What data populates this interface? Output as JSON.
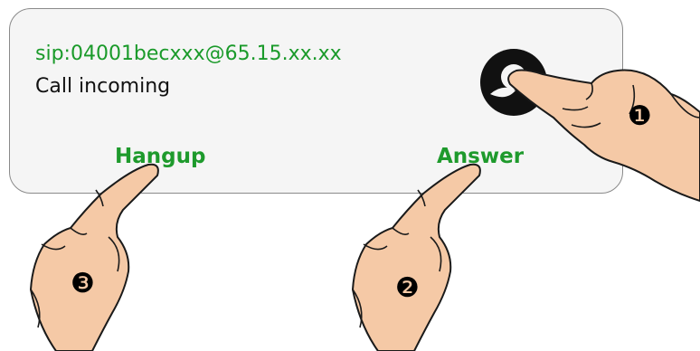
{
  "call": {
    "sip_uri": "sip:04001becxxx@65.15.xx.xx",
    "status": "Call incoming"
  },
  "buttons": {
    "hangup_label": "Hangup",
    "answer_label": "Answer"
  },
  "annotations": {
    "step_1": "❶",
    "step_2": "❷",
    "step_3": "❸"
  },
  "icons": {
    "phone_indicator": "record-icon"
  },
  "colors": {
    "uri_text": "#1a9a2a",
    "button_text": "#1e9a2c",
    "status_text": "#111111",
    "panel_bg": "#f5f5f5",
    "skin": "#f5c9a6",
    "outline": "#1a1a1a"
  }
}
